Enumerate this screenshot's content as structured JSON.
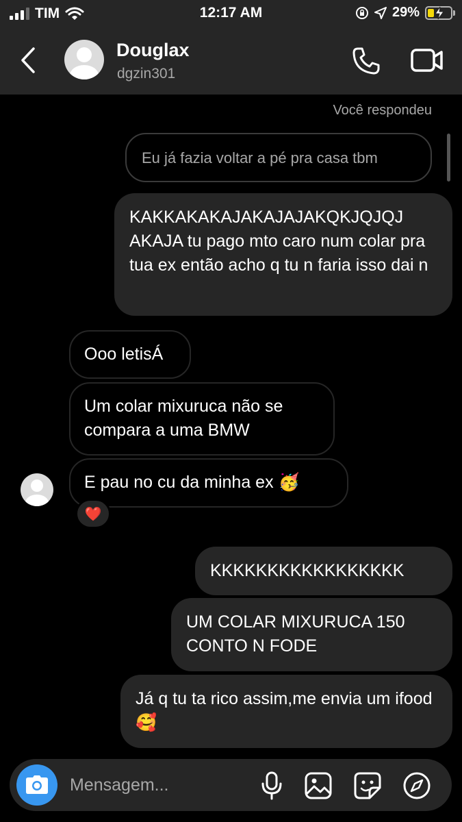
{
  "status_bar": {
    "carrier": "TIM",
    "time": "12:17 AM",
    "battery": "29%",
    "battery_level": 0.29,
    "icons": [
      "cellular-signal-icon",
      "wifi-icon",
      "orientation-lock-icon",
      "location-arrow-icon",
      "battery-charging-icon"
    ]
  },
  "header": {
    "name": "Douglax",
    "username": "dgzin301",
    "icons": [
      "back-chevron-icon",
      "avatar-placeholder",
      "phone-call-icon",
      "video-call-icon"
    ]
  },
  "chat": {
    "reply_label": "Você respondeu",
    "replied_to": "Eu já fazia voltar a pé pra casa tbm",
    "messages": [
      {
        "side": "sent",
        "text": "KAKKAKAKAJAKAJAJAKQKJQJQJ AKAJA tu pago mto caro num colar pra tua ex então acho q tu n faria isso dai n"
      },
      {
        "side": "received",
        "text": "Ooo letisÁ"
      },
      {
        "side": "received",
        "text": "Um colar mixuruca não se compara a uma BMW"
      },
      {
        "side": "received",
        "text": "E pau no cu da minha ex 🥳",
        "reaction": "❤️"
      },
      {
        "side": "sent",
        "text": "KKKKKKKKKKKKKKKKK"
      },
      {
        "side": "sent",
        "text": "UM COLAR MIXURUCA 150 CONTO N FODE"
      },
      {
        "side": "sent",
        "text": "Já q tu ta rico assim,me envia um ifood🥰"
      }
    ]
  },
  "composer": {
    "placeholder": "Mensagem...",
    "icons": [
      "camera-icon",
      "microphone-icon",
      "gallery-icon",
      "sticker-icon",
      "explore-compass-icon"
    ]
  },
  "colors": {
    "background": "#000000",
    "bubble_sent": "#262626",
    "header": "#262626",
    "camera_button": "#3897f0",
    "battery_fill": "#f5d90a",
    "secondary_text": "#a8a8a8"
  }
}
